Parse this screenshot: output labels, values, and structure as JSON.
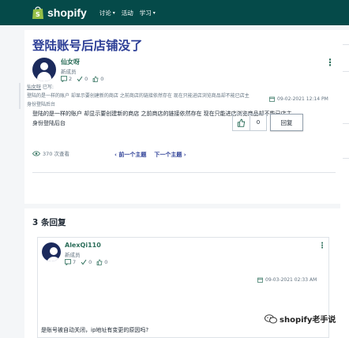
{
  "topbar": {
    "brand": "shopify",
    "nav": [
      {
        "label": "讨论"
      },
      {
        "label": "活动"
      },
      {
        "label": "学习"
      }
    ]
  },
  "post": {
    "title": "登陆账号后店铺没了",
    "author": "仙女呀",
    "role": "新成员",
    "stats": {
      "posts": "2",
      "solutions": "0",
      "kudos": "0"
    },
    "date": "09-02-2021 12:14 PM",
    "body_line1": "登陆的是一样的账户 却显示要创建新的商店   之前商店的链接依然存在 现在只能进店浏览商品却不能已店主",
    "body_line2": "身份登陆后台",
    "views": "370 次查看",
    "kudos_count": "0",
    "reply_label": "回复"
  },
  "pager": {
    "prev": "前一个主题",
    "next": "下一个主题"
  },
  "replies": {
    "heading": "3 条回复",
    "first": {
      "author": "AlexQi110",
      "role": "新成员",
      "stats": {
        "posts": "7",
        "solutions": "0",
        "kudos": "0"
      },
      "date": "09-03-2021 02:33 AM",
      "quote_author": "仙女呀",
      "quote_suffix": " 已写:",
      "quote_line1": "登陆的是一样的账户 却显示要创建新的商店   之前商店的链接依然存在 现在只能进店浏览商品却不能已店主",
      "quote_line2": "身份登陆后台",
      "body": "是账号被自动关闭，ip地址有变更的原因吗?"
    }
  },
  "watermark": "shopify老手说",
  "colors": {
    "topbar": "#054a49",
    "title": "#2c3e96",
    "author": "#2c6e5a",
    "background": "#f4f6f8"
  }
}
